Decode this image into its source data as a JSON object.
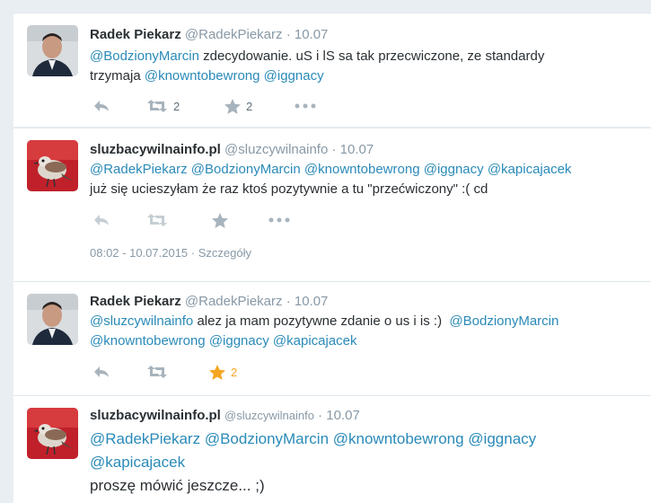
{
  "tweets": [
    {
      "name": "Radek Piekarz",
      "handle": "@RadekPiekarz",
      "date": "10.07",
      "line1": [
        {
          "t": "@BodzionyMarcin",
          "m": true
        },
        {
          "t": " zdecydowanie. uS i lS sa tak przecwiczone, ze standardy",
          "m": false
        }
      ],
      "line2": [
        {
          "t": "trzymaja ",
          "m": false
        },
        {
          "t": "@knowntobewrong",
          "m": true
        },
        {
          "t": " ",
          "m": false
        },
        {
          "t": "@iggnacy",
          "m": true
        }
      ],
      "retweets": "2",
      "favorites": "2"
    },
    {
      "name": "sluzbacywilnainfo.pl",
      "handle": "@sluzcywilnainfo",
      "date": "10.07",
      "line1": [
        {
          "t": "@RadekPiekarz",
          "m": true
        },
        {
          "t": " ",
          "m": false
        },
        {
          "t": "@BodzionyMarcin",
          "m": true
        },
        {
          "t": " ",
          "m": false
        },
        {
          "t": "@knowntobewrong",
          "m": true
        },
        {
          "t": " ",
          "m": false
        },
        {
          "t": "@iggnacy",
          "m": true
        },
        {
          "t": " ",
          "m": false
        },
        {
          "t": "@kapicajacek",
          "m": true
        }
      ],
      "line2": [
        {
          "t": "już się ucieszyłam że raz ktoś pozytywnie a tu \"przećwiczony\" :( cd",
          "m": false
        }
      ],
      "timestamp": "08:02 - 10.07.2015",
      "details": "Szczegóły"
    },
    {
      "name": "Radek Piekarz",
      "handle": "@RadekPiekarz",
      "date": "10.07",
      "line1": [
        {
          "t": "@sluzcywilnainfo",
          "m": true
        },
        {
          "t": " alez ja mam pozytywne zdanie o us i is :)  ",
          "m": false
        },
        {
          "t": "@BodzionyMarcin",
          "m": true
        }
      ],
      "line2": [
        {
          "t": "@knowntobewrong",
          "m": true
        },
        {
          "t": " ",
          "m": false
        },
        {
          "t": "@iggnacy",
          "m": true
        },
        {
          "t": " ",
          "m": false
        },
        {
          "t": "@kapicajacek",
          "m": true
        }
      ],
      "favorites": "2"
    },
    {
      "name": "sluzbacywilnainfo.pl",
      "handle": "@sluzcywilnainfo",
      "date": "10.07",
      "line1": [
        {
          "t": "@RadekPiekarz",
          "m": true
        },
        {
          "t": " ",
          "m": false
        },
        {
          "t": "@BodzionyMarcin",
          "m": true
        },
        {
          "t": " ",
          "m": false
        },
        {
          "t": "@knowntobewrong",
          "m": true
        },
        {
          "t": " ",
          "m": false
        },
        {
          "t": "@iggnacy",
          "m": true
        }
      ],
      "line2": [
        {
          "t": "@kapicajacek",
          "m": true
        }
      ],
      "line3": [
        {
          "t": "proszę mówić jeszcze... ;)",
          "m": false
        }
      ]
    }
  ],
  "colors": {
    "mention": "#2a8ab8",
    "favorited": "#f5a623",
    "icon": "#a8b4bd"
  }
}
